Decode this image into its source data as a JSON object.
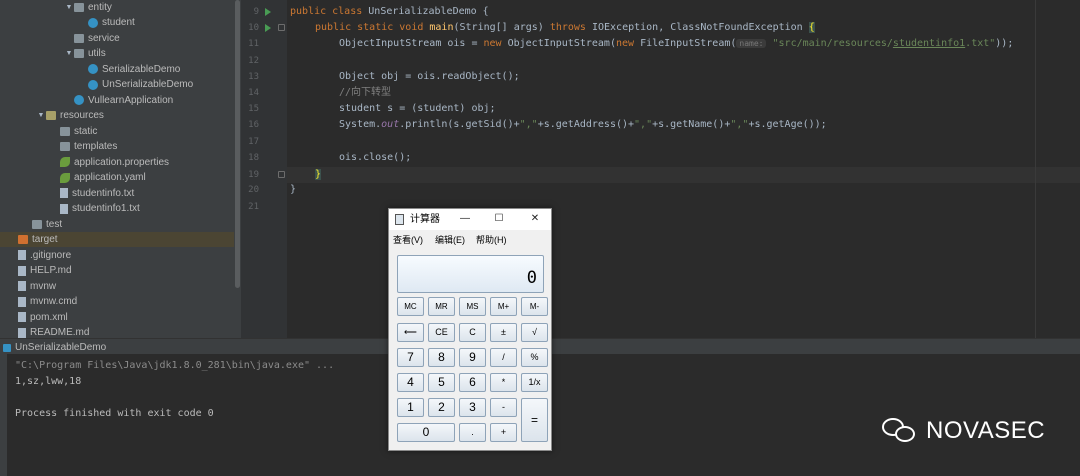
{
  "project_tree": [
    {
      "label": "entity",
      "indent": 2,
      "kind": "folder",
      "expanded": true
    },
    {
      "label": "student",
      "indent": 3,
      "kind": "class"
    },
    {
      "label": "service",
      "indent": 2,
      "kind": "folder"
    },
    {
      "label": "utils",
      "indent": 2,
      "kind": "folder",
      "expanded": true
    },
    {
      "label": "SerializableDemo",
      "indent": 3,
      "kind": "class"
    },
    {
      "label": "UnSerializableDemo",
      "indent": 3,
      "kind": "class"
    },
    {
      "label": "VullearnApplication",
      "indent": 2,
      "kind": "class"
    },
    {
      "label": "resources",
      "indent": 0,
      "kind": "folder-res",
      "expanded": true
    },
    {
      "label": "static",
      "indent": 1,
      "kind": "folder"
    },
    {
      "label": "templates",
      "indent": 1,
      "kind": "folder"
    },
    {
      "label": "application.properties",
      "indent": 1,
      "kind": "leaf"
    },
    {
      "label": "application.yaml",
      "indent": 1,
      "kind": "leaf"
    },
    {
      "label": "studentinfo.txt",
      "indent": 1,
      "kind": "file"
    },
    {
      "label": "studentinfo1.txt",
      "indent": 1,
      "kind": "file"
    },
    {
      "label": "test",
      "indent": -1,
      "kind": "folder"
    },
    {
      "label": "target",
      "indent": -2,
      "kind": "folder-excl",
      "highlight": true
    },
    {
      "label": ".gitignore",
      "indent": -2,
      "kind": "file"
    },
    {
      "label": "HELP.md",
      "indent": -2,
      "kind": "file"
    },
    {
      "label": "mvnw",
      "indent": -2,
      "kind": "file"
    },
    {
      "label": "mvnw.cmd",
      "indent": -2,
      "kind": "file"
    },
    {
      "label": "pom.xml",
      "indent": -2,
      "kind": "file"
    },
    {
      "label": "README.md",
      "indent": -2,
      "kind": "file"
    }
  ],
  "editor": {
    "line_numbers": [
      "9",
      "10",
      "11",
      "12",
      "13",
      "14",
      "15",
      "16",
      "17",
      "18",
      "19",
      "20",
      "21"
    ],
    "code": {
      "l9_kw": "public class ",
      "l9_name": "UnSerializableDemo {",
      "l10_kw1": "public static void ",
      "l10_fn": "main",
      "l10_args": "(String[] args) ",
      "l10_kw2": "throws ",
      "l10_ex": "IOException, ClassNotFoundException ",
      "l10_brace": "{",
      "l11_a": "ObjectInputStream ois = ",
      "l11_kw": "new ",
      "l11_b": "ObjectInputStream(",
      "l11_kw2": "new ",
      "l11_c": "FileInputStream(",
      "l11_hint": "name:",
      "l11_str1": " \"src/main/resources/",
      "l11_str_und": "studentinfo1",
      "l11_str2": ".txt\"",
      "l11_end": "));",
      "l13": "Object obj = ois.readObject();",
      "l14": "//向下转型",
      "l15": "student s = (student) obj;",
      "l16_a": "System.",
      "l16_out": "out",
      "l16_b": ".println(s.getSid()+",
      "l16_s1": "\",\"",
      "l16_c": "+s.getAddress()+",
      "l16_s2": "\",\"",
      "l16_d": "+s.getName()+",
      "l16_s3": "\",\"",
      "l16_e": "+s.getAge());",
      "l18": "ois.close();",
      "l19": "}",
      "l20": "}"
    }
  },
  "run_panel": {
    "tab_label": "UnSerializableDemo",
    "lines": [
      "\"C:\\Program Files\\Java\\jdk1.8.0_281\\bin\\java.exe\" ...",
      "1,sz,lww,18",
      "",
      "Process finished with exit code 0"
    ]
  },
  "calculator": {
    "title": "计算器",
    "window_buttons": {
      "minimize": "—",
      "maximize": "☐",
      "close": "✕"
    },
    "menu": [
      "查看(V)",
      "编辑(E)",
      "帮助(H)"
    ],
    "display": "0",
    "buttons": {
      "row1": [
        "MC",
        "MR",
        "MS",
        "M+",
        "M-"
      ],
      "row2": [
        "⟵",
        "CE",
        "C",
        "±",
        "√"
      ],
      "row3": [
        "7",
        "8",
        "9",
        "/",
        "%"
      ],
      "row4": [
        "4",
        "5",
        "6",
        "*",
        "1/x"
      ],
      "row5": [
        "1",
        "2",
        "3",
        "-"
      ],
      "row6": [
        "0",
        ".",
        "+"
      ],
      "equals": "="
    }
  },
  "watermark": {
    "text": "NOVASEC"
  }
}
